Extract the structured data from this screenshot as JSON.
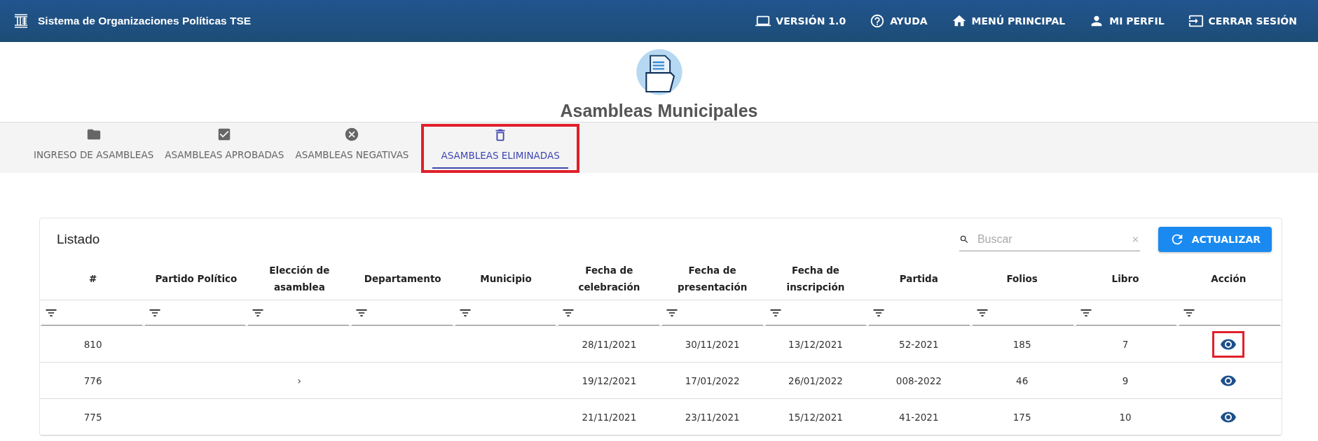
{
  "app_bar": {
    "title": "Sistema de Organizaciones Políticas TSE",
    "actions": [
      {
        "kind": "laptop",
        "label": "VERSIÓN 1.0"
      },
      {
        "kind": "help",
        "label": "AYUDA"
      },
      {
        "kind": "home",
        "label": "MENÚ PRINCIPAL"
      },
      {
        "kind": "person",
        "label": "MI PERFIL"
      },
      {
        "kind": "logout",
        "label": "CERRAR SESIÓN"
      }
    ]
  },
  "page": {
    "title": "Asambleas Municipales"
  },
  "tabs": [
    {
      "kind": "folder",
      "label": "INGRESO DE ASAMBLEAS",
      "selected": false,
      "highlighted": false
    },
    {
      "kind": "check",
      "label": "ASAMBLEAS APROBADAS",
      "selected": false,
      "highlighted": false
    },
    {
      "kind": "cancel",
      "label": "ASAMBLEAS NEGATIVAS",
      "selected": false,
      "highlighted": false
    },
    {
      "kind": "trash",
      "label": "ASAMBLEAS ELIMINADAS",
      "selected": true,
      "highlighted": true
    }
  ],
  "listing": {
    "title": "Listado",
    "search": {
      "placeholder": "Buscar"
    },
    "refresh_button": "ACTUALIZAR",
    "columns": [
      "#",
      "Partido Político",
      "Elección de asamblea",
      "Departamento",
      "Municipio",
      "Fecha de celebración",
      "Fecha de presentación",
      "Fecha de inscripción",
      "Partida",
      "Folios",
      "Libro",
      "Acción"
    ],
    "rows": [
      {
        "cells": [
          "810",
          "",
          "",
          "",
          "",
          "28/11/2021",
          "30/11/2021",
          "13/12/2021",
          "52-2021",
          "185",
          "7"
        ],
        "action_highlighted": true
      },
      {
        "cells": [
          "776",
          "",
          "›",
          "",
          "",
          "19/12/2021",
          "17/01/2022",
          "26/01/2022",
          "008-2022",
          "46",
          "9"
        ],
        "action_highlighted": false
      },
      {
        "cells": [
          "775",
          "",
          "",
          "",
          "",
          "21/11/2021",
          "23/11/2021",
          "15/12/2021",
          "41-2021",
          "175",
          "10"
        ],
        "action_highlighted": false
      }
    ]
  }
}
